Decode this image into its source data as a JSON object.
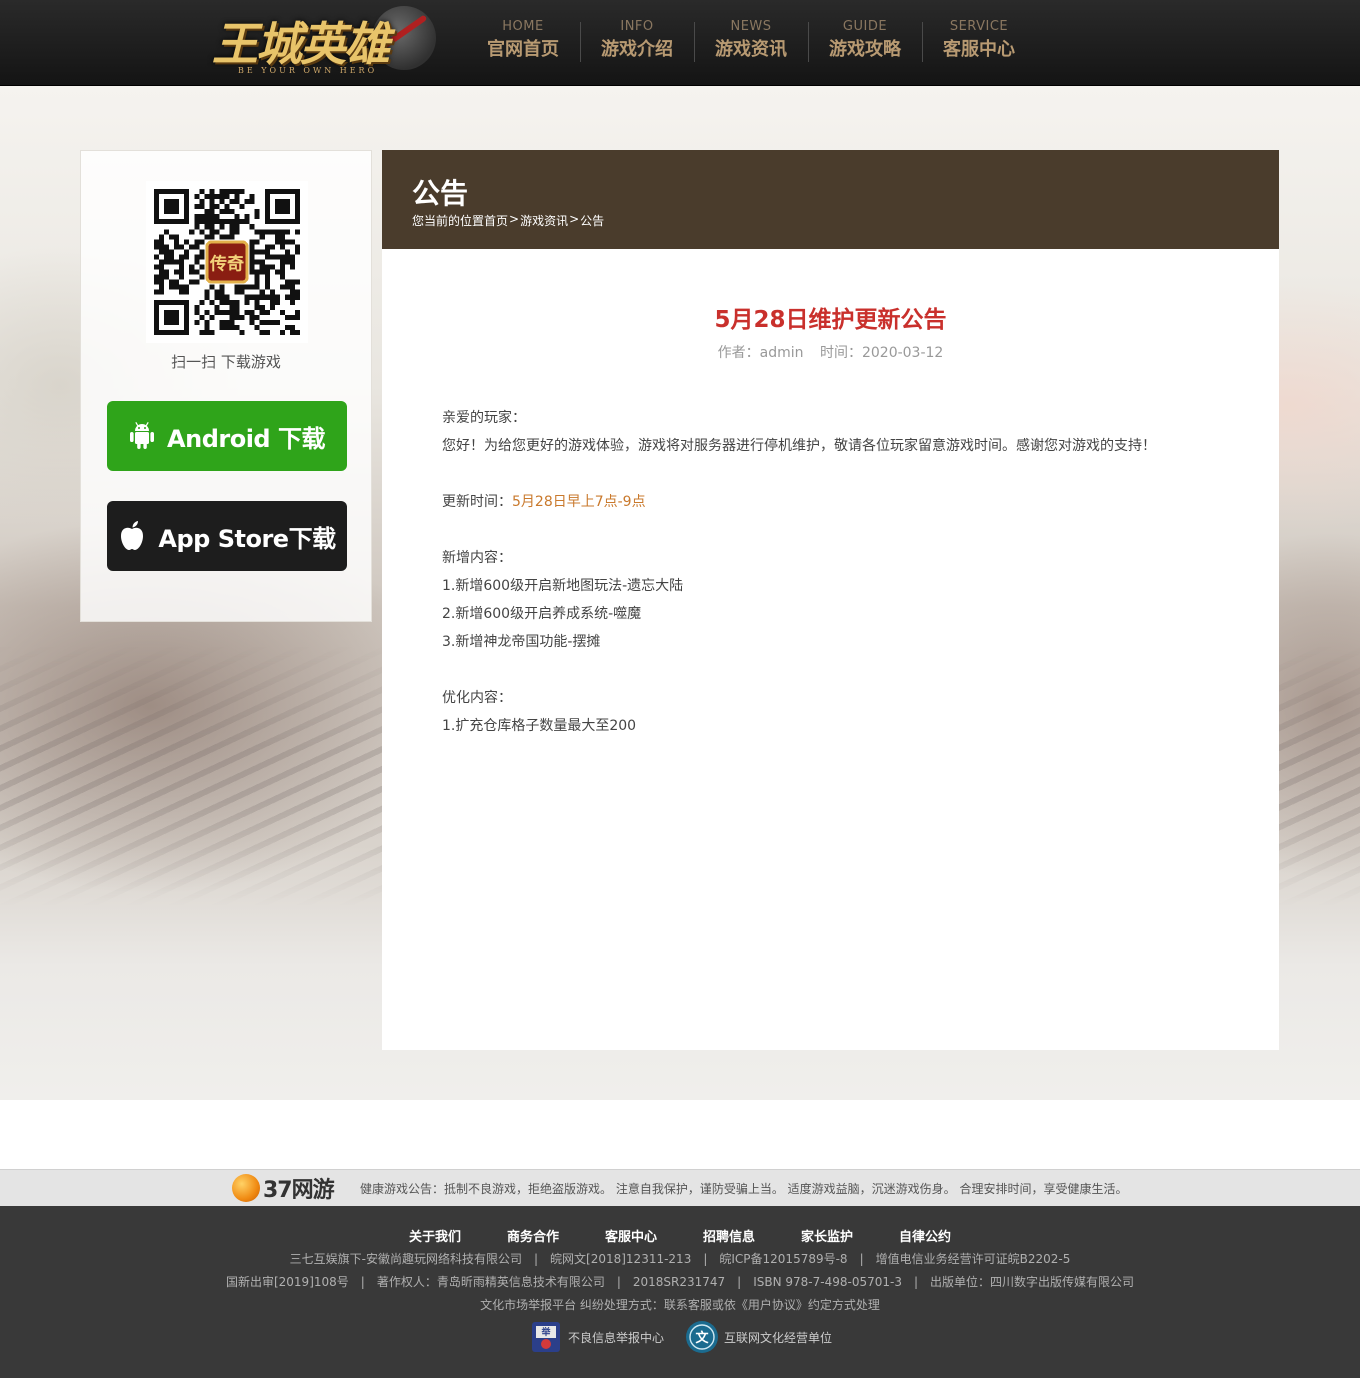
{
  "header": {
    "logo_text": "王城英雄",
    "logo_tagline": "BE YOUR OWN HERO",
    "nav": [
      {
        "en": "HOME",
        "cn": "官网首页"
      },
      {
        "en": "INFO",
        "cn": "游戏介绍"
      },
      {
        "en": "NEWS",
        "cn": "游戏资讯"
      },
      {
        "en": "GUIDE",
        "cn": "游戏攻略"
      },
      {
        "en": "SERVICE",
        "cn": "客服中心"
      }
    ]
  },
  "sidebar": {
    "qr_caption": "扫一扫 下载游戏",
    "qr_center_text": "传奇",
    "android_label": "Android 下载",
    "ios_label": "App Store下载"
  },
  "article": {
    "section_title": "公告",
    "breadcrumb": {
      "prefix": "您当前的位置",
      "items": [
        "首页",
        "游戏资讯",
        "公告"
      ],
      "separator": ">"
    },
    "title": "5月28日维护更新公告",
    "author": "作者：admin",
    "time": "时间：2020-03-12",
    "lines": {
      "greeting": "亲爱的玩家：",
      "intro": "您好！为给您更好的游戏体验，游戏将对服务器进行停机维护，敬请各位玩家留意游戏时间。感谢您对游戏的支持！",
      "update_label": "更新时间：",
      "update_value": "5月28日早上7点-9点",
      "new_heading": "新增内容：",
      "new_items": [
        "1.新增600级开启新地图玩法-遗忘大陆",
        "2.新增600级开启养成系统-噬魔",
        "3.新增神龙帝国功能-摆摊"
      ],
      "opt_heading": "优化内容：",
      "opt_items": [
        "1.扩充仓库格子数量最大至200"
      ]
    }
  },
  "footer": {
    "brand": "37网游",
    "health_notice": "健康游戏公告：抵制不良游戏，拒绝盗版游戏。 注意自我保护，谨防受骗上当。 适度游戏益脑，沉迷游戏伤身。 合理安排时间，享受健康生活。",
    "links": [
      "关于我们",
      "商务合作",
      "客服中心",
      "招聘信息",
      "家长监护",
      "自律公约"
    ],
    "line1": "三七互娱旗下-安徽尚趣玩网络科技有限公司　|　皖网文[2018]12311-213　|　皖ICP备12015789号-8　|　增值电信业务经营许可证皖B2202-5",
    "line2": "国新出审[2019]108号　|　著作权人：青岛昕雨精英信息技术有限公司　|　2018SR231747　|　ISBN 978-7-498-05701-3　|　出版单位：四川数字出版传媒有限公司",
    "line3": "文化市场举报平台 纠纷处理方式：联系客服或依《用户协议》约定方式处理",
    "badges": [
      {
        "label": "不良信息举报中心",
        "badge_text": "举"
      },
      {
        "label": "互联网文化经营单位",
        "badge_text": "文"
      }
    ]
  },
  "colors": {
    "header_bg": "#1d1d1d",
    "nav_text": "#b89a72",
    "article_head": "#4a3c2c",
    "title_red": "#c9302c",
    "highlight_orange": "#c9792c",
    "android_green": "#2fa41a",
    "ios_black": "#1d1d1d",
    "footer_bg": "#393939"
  }
}
